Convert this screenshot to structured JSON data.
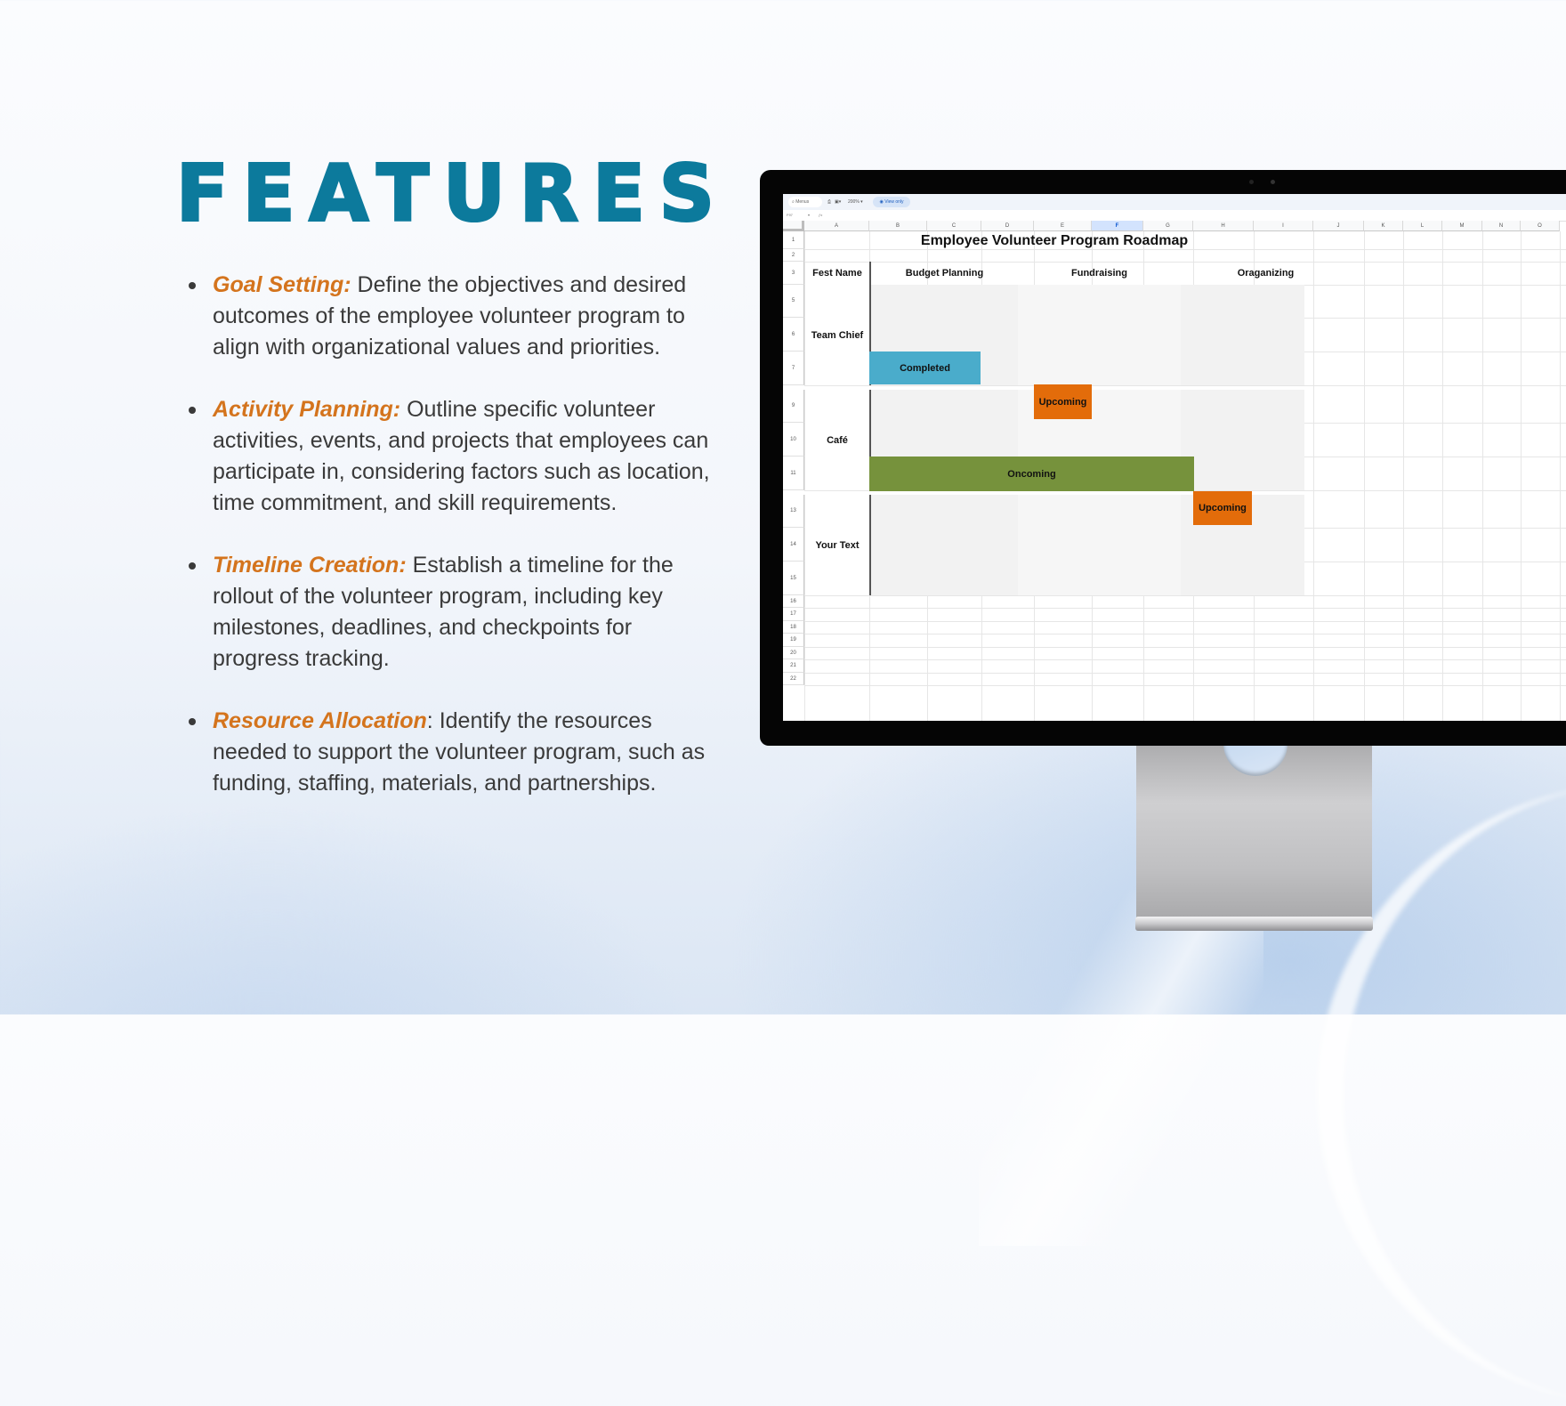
{
  "heading": "FEATURES",
  "features": [
    {
      "title": "Goal Setting:",
      "text": " Define the objectives and desired outcomes of the employee volunteer program to align with organizational values and priorities."
    },
    {
      "title": "Activity Planning:",
      "text": " Outline specific volunteer activities, events, and projects that employees can participate in, considering factors such as location, time commitment, and skill requirements."
    },
    {
      "title": "Timeline Creation:",
      "text": " Establish a timeline for the rollout of the volunteer program, including key milestones, deadlines, and checkpoints for progress tracking."
    },
    {
      "title": "Resource Allocation",
      "text": ": Identify the resources needed to support the volunteer program, such as funding, staffing, materials, and partnerships."
    }
  ],
  "colors": {
    "heading": "#0c7a9c",
    "feature_title": "#d4741d",
    "completed": "#4aaccb",
    "upcoming": "#e36c0a",
    "oncoming": "#76923c"
  },
  "spreadsheet": {
    "toolbar": {
      "search_label": "Menus",
      "zoom": "200%",
      "view_mode": "View only"
    },
    "formula_bar": {
      "cell_ref": "F97"
    },
    "columns": [
      "A",
      "B",
      "C",
      "D",
      "E",
      "F",
      "G",
      "H",
      "I",
      "J",
      "K",
      "L",
      "M",
      "N",
      "O"
    ],
    "selected_column": "F",
    "row_numbers": [
      "1",
      "2",
      "3",
      "5",
      "6",
      "7",
      "9",
      "10",
      "11",
      "13",
      "14",
      "15",
      "16",
      "17",
      "18",
      "19",
      "20",
      "21",
      "22"
    ],
    "title": "Employee Volunteer Program Roadmap",
    "header_label": "Fest Name",
    "phases": [
      "Budget Planning",
      "Fundraising",
      "Oraganizing"
    ],
    "groups": [
      {
        "name": "Team Chief",
        "tasks": [
          {
            "label": "Completed",
            "status": "completed",
            "row": 6
          },
          {
            "label": "Upcoming",
            "status": "upcoming",
            "row": 7
          }
        ]
      },
      {
        "name": "Café",
        "tasks": [
          {
            "label": "Oncoming",
            "status": "oncoming",
            "row": 10
          },
          {
            "label": "Upcoming",
            "status": "upcoming",
            "row": 11
          }
        ]
      },
      {
        "name": "Your Text",
        "tasks": []
      }
    ]
  }
}
